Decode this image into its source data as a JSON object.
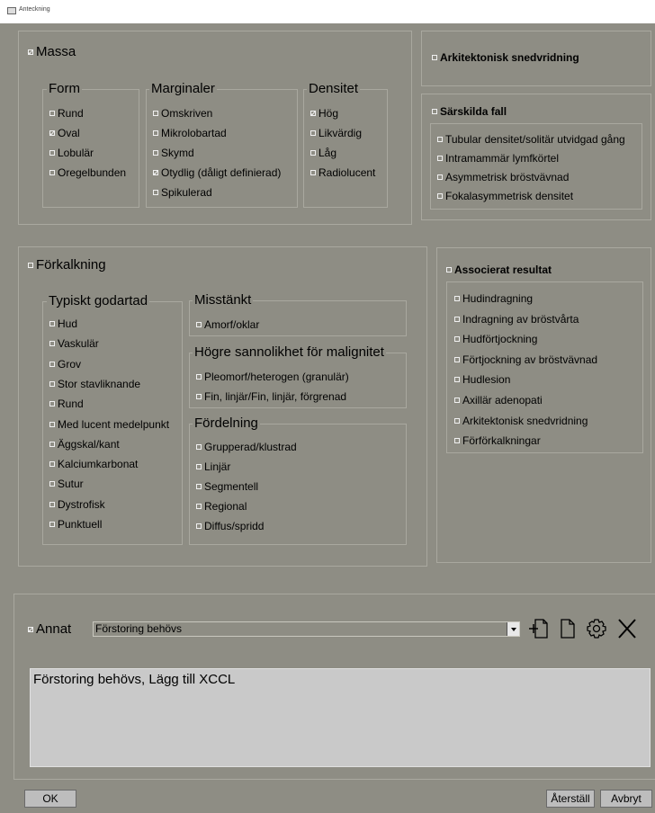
{
  "window": {
    "title": "Anteckning"
  },
  "massa": {
    "label": "Massa",
    "checked": true,
    "form": {
      "title": "Form",
      "items": [
        {
          "label": "Rund",
          "checked": false
        },
        {
          "label": "Oval",
          "checked": true
        },
        {
          "label": "Lobulär",
          "checked": false
        },
        {
          "label": "Oregelbunden",
          "checked": false
        }
      ]
    },
    "marginaler": {
      "title": "Marginaler",
      "items": [
        {
          "label": "Omskriven",
          "checked": false
        },
        {
          "label": "Mikrolobartad",
          "checked": false
        },
        {
          "label": "Skymd",
          "checked": false
        },
        {
          "label": "Otydlig (dåligt definierad)",
          "checked": true
        },
        {
          "label": "Spikulerad",
          "checked": false
        }
      ]
    },
    "densitet": {
      "title": "Densitet",
      "items": [
        {
          "label": "Hög",
          "checked": true
        },
        {
          "label": "Likvärdig",
          "checked": false
        },
        {
          "label": "Låg",
          "checked": false
        },
        {
          "label": "Radiolucent",
          "checked": false
        }
      ]
    }
  },
  "arkitektonisk": {
    "label": "Arkitektonisk snedvridning",
    "checked": false
  },
  "sarskilda": {
    "label": "Särskilda fall",
    "checked": false,
    "items": [
      {
        "label": "Tubular densitet/solitär utvidgad gång",
        "checked": false
      },
      {
        "label": "Intramammär lymfkörtel",
        "checked": false
      },
      {
        "label": "Asymmetrisk bröstvävnad",
        "checked": false
      },
      {
        "label": "Fokalasymmetrisk densitet",
        "checked": false
      }
    ]
  },
  "forkalkning": {
    "label": "Förkalkning",
    "checked": false,
    "typiskt": {
      "title": "Typiskt godartad",
      "items": [
        {
          "label": "Hud",
          "checked": false
        },
        {
          "label": "Vaskulär",
          "checked": false
        },
        {
          "label": "Grov",
          "checked": false
        },
        {
          "label": "Stor stavliknande",
          "checked": false
        },
        {
          "label": "Rund",
          "checked": false
        },
        {
          "label": "Med lucent medelpunkt",
          "checked": false
        },
        {
          "label": "Äggskal/kant",
          "checked": false
        },
        {
          "label": "Kalciumkarbonat",
          "checked": false
        },
        {
          "label": "Sutur",
          "checked": false
        },
        {
          "label": "Dystrofisk",
          "checked": false
        },
        {
          "label": "Punktuell",
          "checked": false
        }
      ]
    },
    "misstankt": {
      "title": "Misstänkt",
      "items": [
        {
          "label": "Amorf/oklar",
          "checked": false
        }
      ]
    },
    "hogre": {
      "title": "Högre sannolikhet för malignitet",
      "items": [
        {
          "label": "Pleomorf/heterogen (granulär)",
          "checked": false
        },
        {
          "label": "Fin, linjär/Fin, linjär, förgrenad",
          "checked": false
        }
      ]
    },
    "fordelning": {
      "title": "Fördelning",
      "items": [
        {
          "label": "Grupperad/klustrad",
          "checked": false
        },
        {
          "label": "Linjär",
          "checked": false
        },
        {
          "label": "Segmentell",
          "checked": false
        },
        {
          "label": "Regional",
          "checked": false
        },
        {
          "label": "Diffus/spridd",
          "checked": false
        }
      ]
    }
  },
  "associerat": {
    "label": "Associerat resultat",
    "checked": false,
    "items": [
      {
        "label": "Hudindragning",
        "checked": false
      },
      {
        "label": "Indragning av bröstvårta",
        "checked": false
      },
      {
        "label": "Hudförtjockning",
        "checked": false
      },
      {
        "label": "Förtjockning av bröstvävnad",
        "checked": false
      },
      {
        "label": "Hudlesion",
        "checked": false
      },
      {
        "label": "Axillär adenopati",
        "checked": false
      },
      {
        "label": "Arkitektonisk snedvridning",
        "checked": false
      },
      {
        "label": "Förförkalkningar",
        "checked": false
      }
    ]
  },
  "annat": {
    "label": "Annat",
    "checked": true,
    "selected": "Förstoring behövs"
  },
  "notes": {
    "text": "Förstoring behövs, Lägg till XCCL"
  },
  "buttons": {
    "ok": "OK",
    "reset": "Återställ",
    "cancel": "Avbryt"
  },
  "toolbar_icons": [
    "add-template-icon",
    "new-document-icon",
    "gear-icon",
    "close-icon"
  ]
}
